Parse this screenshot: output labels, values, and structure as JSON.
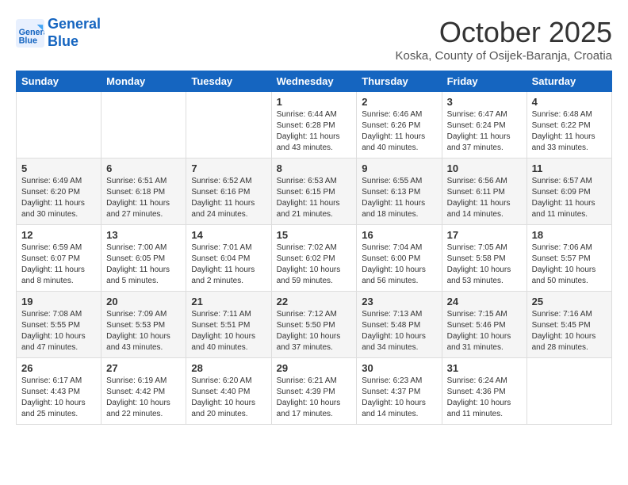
{
  "header": {
    "logo_line1": "General",
    "logo_line2": "Blue",
    "month_title": "October 2025",
    "subtitle": "Koska, County of Osijek-Baranja, Croatia"
  },
  "weekdays": [
    "Sunday",
    "Monday",
    "Tuesday",
    "Wednesday",
    "Thursday",
    "Friday",
    "Saturday"
  ],
  "weeks": [
    [
      {
        "day": "",
        "info": ""
      },
      {
        "day": "",
        "info": ""
      },
      {
        "day": "",
        "info": ""
      },
      {
        "day": "1",
        "info": "Sunrise: 6:44 AM\nSunset: 6:28 PM\nDaylight: 11 hours\nand 43 minutes."
      },
      {
        "day": "2",
        "info": "Sunrise: 6:46 AM\nSunset: 6:26 PM\nDaylight: 11 hours\nand 40 minutes."
      },
      {
        "day": "3",
        "info": "Sunrise: 6:47 AM\nSunset: 6:24 PM\nDaylight: 11 hours\nand 37 minutes."
      },
      {
        "day": "4",
        "info": "Sunrise: 6:48 AM\nSunset: 6:22 PM\nDaylight: 11 hours\nand 33 minutes."
      }
    ],
    [
      {
        "day": "5",
        "info": "Sunrise: 6:49 AM\nSunset: 6:20 PM\nDaylight: 11 hours\nand 30 minutes."
      },
      {
        "day": "6",
        "info": "Sunrise: 6:51 AM\nSunset: 6:18 PM\nDaylight: 11 hours\nand 27 minutes."
      },
      {
        "day": "7",
        "info": "Sunrise: 6:52 AM\nSunset: 6:16 PM\nDaylight: 11 hours\nand 24 minutes."
      },
      {
        "day": "8",
        "info": "Sunrise: 6:53 AM\nSunset: 6:15 PM\nDaylight: 11 hours\nand 21 minutes."
      },
      {
        "day": "9",
        "info": "Sunrise: 6:55 AM\nSunset: 6:13 PM\nDaylight: 11 hours\nand 18 minutes."
      },
      {
        "day": "10",
        "info": "Sunrise: 6:56 AM\nSunset: 6:11 PM\nDaylight: 11 hours\nand 14 minutes."
      },
      {
        "day": "11",
        "info": "Sunrise: 6:57 AM\nSunset: 6:09 PM\nDaylight: 11 hours\nand 11 minutes."
      }
    ],
    [
      {
        "day": "12",
        "info": "Sunrise: 6:59 AM\nSunset: 6:07 PM\nDaylight: 11 hours\nand 8 minutes."
      },
      {
        "day": "13",
        "info": "Sunrise: 7:00 AM\nSunset: 6:05 PM\nDaylight: 11 hours\nand 5 minutes."
      },
      {
        "day": "14",
        "info": "Sunrise: 7:01 AM\nSunset: 6:04 PM\nDaylight: 11 hours\nand 2 minutes."
      },
      {
        "day": "15",
        "info": "Sunrise: 7:02 AM\nSunset: 6:02 PM\nDaylight: 10 hours\nand 59 minutes."
      },
      {
        "day": "16",
        "info": "Sunrise: 7:04 AM\nSunset: 6:00 PM\nDaylight: 10 hours\nand 56 minutes."
      },
      {
        "day": "17",
        "info": "Sunrise: 7:05 AM\nSunset: 5:58 PM\nDaylight: 10 hours\nand 53 minutes."
      },
      {
        "day": "18",
        "info": "Sunrise: 7:06 AM\nSunset: 5:57 PM\nDaylight: 10 hours\nand 50 minutes."
      }
    ],
    [
      {
        "day": "19",
        "info": "Sunrise: 7:08 AM\nSunset: 5:55 PM\nDaylight: 10 hours\nand 47 minutes."
      },
      {
        "day": "20",
        "info": "Sunrise: 7:09 AM\nSunset: 5:53 PM\nDaylight: 10 hours\nand 43 minutes."
      },
      {
        "day": "21",
        "info": "Sunrise: 7:11 AM\nSunset: 5:51 PM\nDaylight: 10 hours\nand 40 minutes."
      },
      {
        "day": "22",
        "info": "Sunrise: 7:12 AM\nSunset: 5:50 PM\nDaylight: 10 hours\nand 37 minutes."
      },
      {
        "day": "23",
        "info": "Sunrise: 7:13 AM\nSunset: 5:48 PM\nDaylight: 10 hours\nand 34 minutes."
      },
      {
        "day": "24",
        "info": "Sunrise: 7:15 AM\nSunset: 5:46 PM\nDaylight: 10 hours\nand 31 minutes."
      },
      {
        "day": "25",
        "info": "Sunrise: 7:16 AM\nSunset: 5:45 PM\nDaylight: 10 hours\nand 28 minutes."
      }
    ],
    [
      {
        "day": "26",
        "info": "Sunrise: 6:17 AM\nSunset: 4:43 PM\nDaylight: 10 hours\nand 25 minutes."
      },
      {
        "day": "27",
        "info": "Sunrise: 6:19 AM\nSunset: 4:42 PM\nDaylight: 10 hours\nand 22 minutes."
      },
      {
        "day": "28",
        "info": "Sunrise: 6:20 AM\nSunset: 4:40 PM\nDaylight: 10 hours\nand 20 minutes."
      },
      {
        "day": "29",
        "info": "Sunrise: 6:21 AM\nSunset: 4:39 PM\nDaylight: 10 hours\nand 17 minutes."
      },
      {
        "day": "30",
        "info": "Sunrise: 6:23 AM\nSunset: 4:37 PM\nDaylight: 10 hours\nand 14 minutes."
      },
      {
        "day": "31",
        "info": "Sunrise: 6:24 AM\nSunset: 4:36 PM\nDaylight: 10 hours\nand 11 minutes."
      },
      {
        "day": "",
        "info": ""
      }
    ]
  ]
}
